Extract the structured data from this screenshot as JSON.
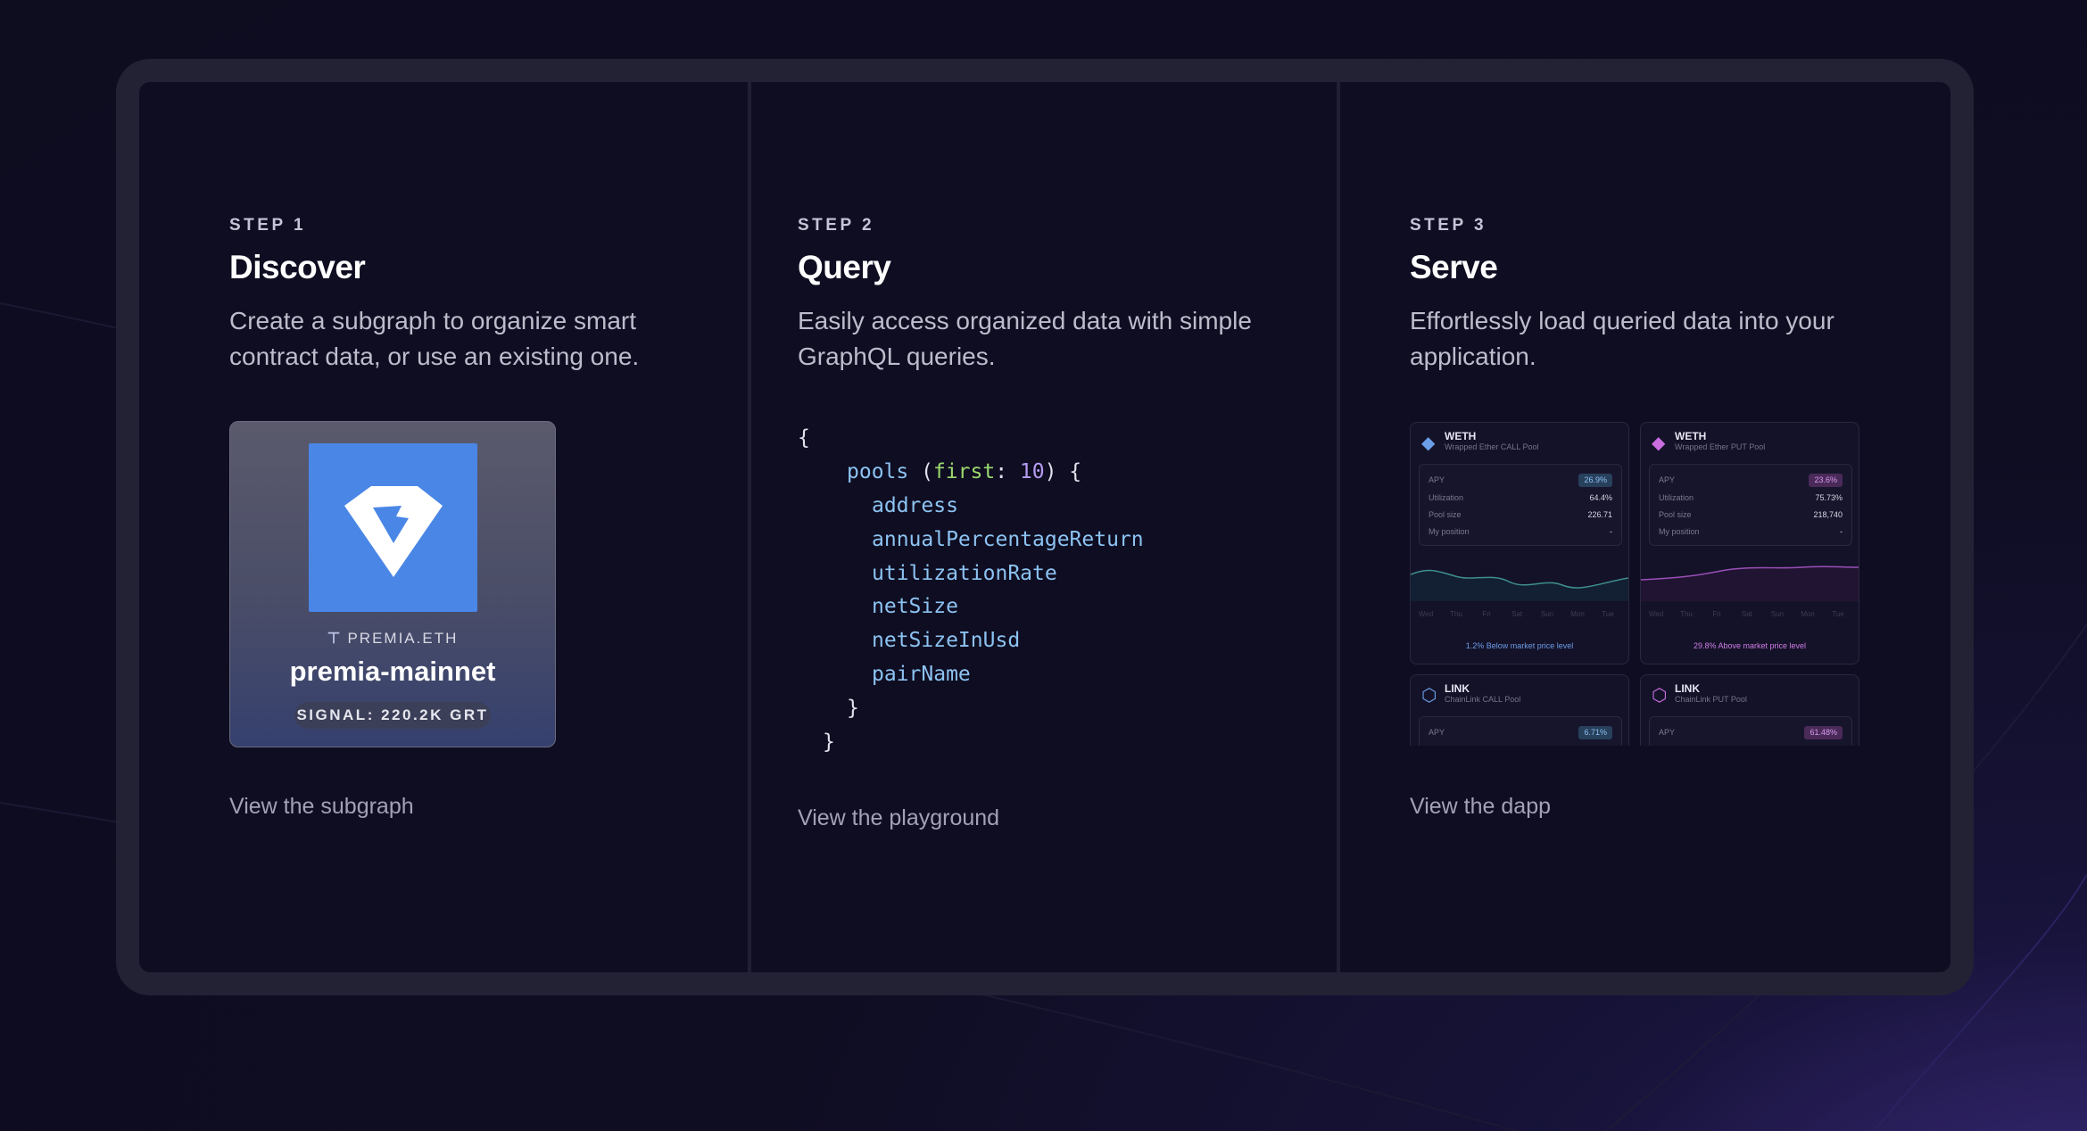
{
  "steps": [
    {
      "label": "STEP 1",
      "title": "Discover",
      "description": "Create a subgraph to organize smart contract data, or use an existing one.",
      "link": "View the subgraph",
      "subgraph_card": {
        "owner": "PREMIA.ETH",
        "name": "premia-mainnet",
        "signal": "SIGNAL: 220.2K GRT"
      }
    },
    {
      "label": "STEP 2",
      "title": "Query",
      "description": "Easily access organized data with simple GraphQL queries.",
      "link": "View the playground",
      "code": {
        "open_brace": "{",
        "query_name": "pools",
        "arg_name": "first",
        "arg_value": "10",
        "fields": [
          "address",
          "annualPercentageReturn",
          "utilizationRate",
          "netSize",
          "netSizeInUsd",
          "pairName"
        ],
        "close_inner": "}",
        "close_outer": "}"
      }
    },
    {
      "label": "STEP 3",
      "title": "Serve",
      "description": "Effortlessly load queried data into your application.",
      "link": "View the dapp",
      "pools": [
        {
          "token": "WETH",
          "pool_name": "Wrapped Ether CALL Pool",
          "apy_label": "APY",
          "apy": "26.9%",
          "utilization_label": "Utilization",
          "utilization": "64.4%",
          "pool_size_label": "Pool size",
          "pool_size": "226.71",
          "position_label": "My position",
          "position": "-",
          "footer": "1.2% Below market price level",
          "accent": "#5c8fe6"
        },
        {
          "token": "WETH",
          "pool_name": "Wrapped Ether PUT Pool",
          "apy_label": "APY",
          "apy": "23.6%",
          "utilization_label": "Utilization",
          "utilization": "75.73%",
          "pool_size_label": "Pool size",
          "pool_size": "218,740",
          "position_label": "My position",
          "position": "-",
          "footer": "29.8% Above market price level",
          "accent": "#c86ee0"
        },
        {
          "token": "LINK",
          "pool_name": "ChainLink CALL Pool",
          "apy_label": "APY",
          "apy": "6.71%",
          "accent": "#5c8fe6"
        },
        {
          "token": "LINK",
          "pool_name": "ChainLink PUT Pool",
          "apy_label": "APY",
          "apy": "61.48%",
          "accent": "#c86ee0"
        }
      ],
      "chart_days": [
        "Wed",
        "Thu",
        "Fri",
        "Sat",
        "Sun",
        "Mon",
        "Tue"
      ]
    }
  ]
}
